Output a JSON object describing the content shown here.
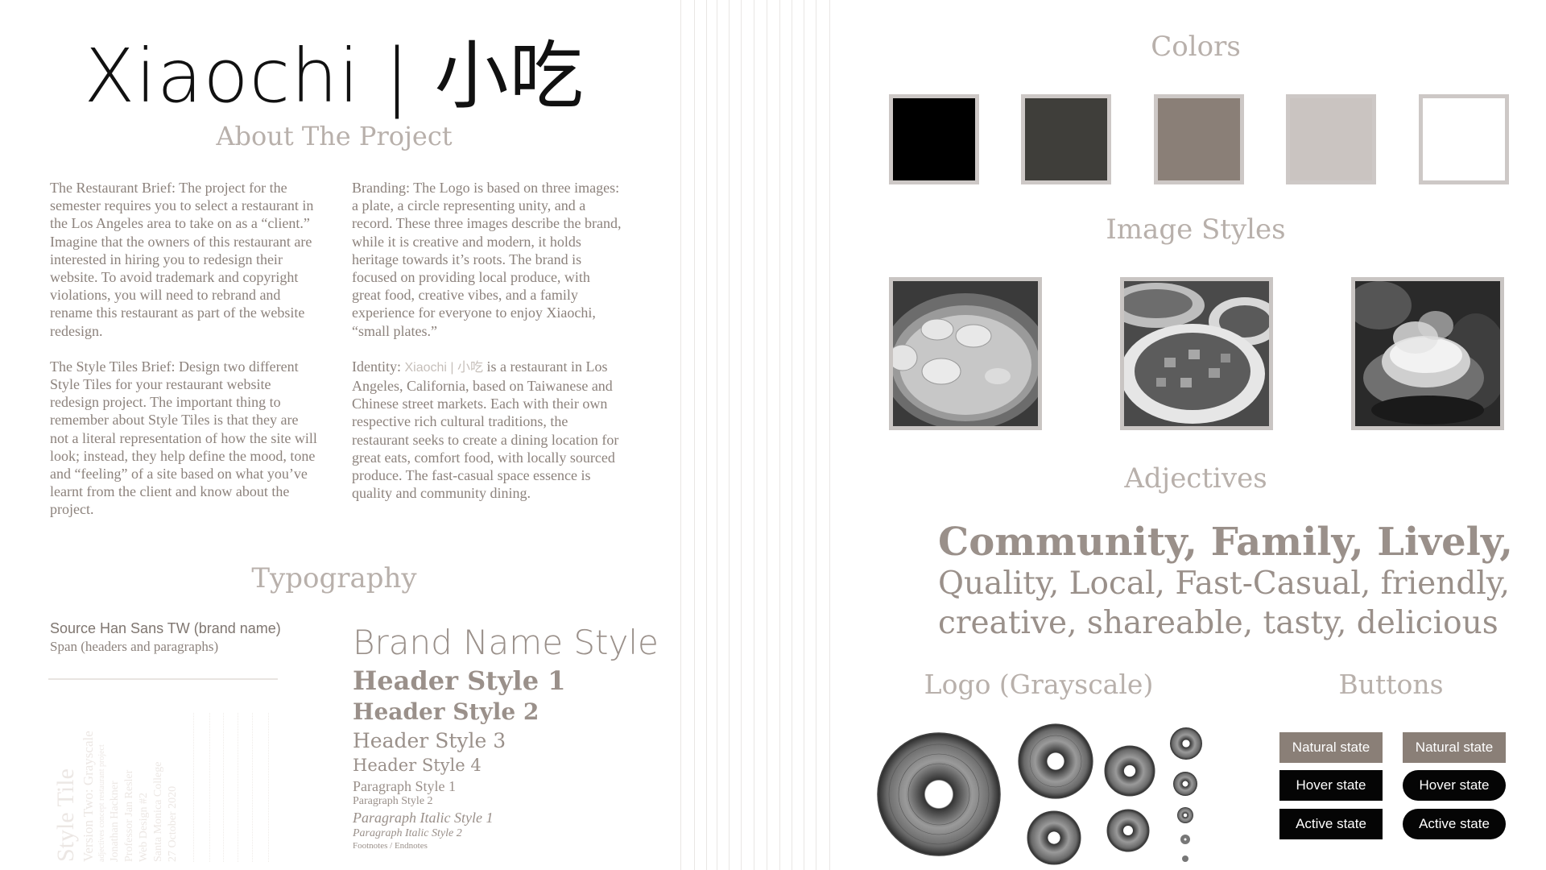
{
  "brand": {
    "title": "Xiaochi | 小吃"
  },
  "about": {
    "heading": "About The Project",
    "col1": [
      "The Restaurant Brief: The project for the semester requires you to select a restaurant in the Los Angeles area to take on as a “client.” Imagine that the owners of this restaurant are interested in hiring you to redesign their website. To avoid trademark and copyright violations, you will need to rebrand and rename this restaurant as part of the website redesign.",
      "The Style Tiles Brief: Design two different Style Tiles for your restaurant website redesign project. The important thing to remember about Style Tiles is that they are not a literal representation of how the site will look; instead, they help define the mood, tone and “feeling” of a site based on what you’ve learnt from the client and know about the project."
    ],
    "col2_p1": "Branding: The Logo is based on three images: a plate, a circle representing unity, and a record. These three images describe the brand, while it is creative and modern, it holds heritage towards it’s roots. The brand is focused on providing local produce, with great food, creative vibes, and a family experience for everyone to enjoy Xiaochi, “small plates.”",
    "identity_prefix": "Identity: ",
    "identity_brand": "Xiaochi | 小吃",
    "identity_rest": " is a restaurant in Los Angeles, California, based on Taiwanese and Chinese street markets. Each with their own respective rich cultural traditions, the restaurant seeks to create a dining location for great eats, comfort food, with locally sourced produce. The fast-casual space essence is quality and community dining."
  },
  "typography": {
    "heading": "Typography",
    "font1": "Source Han Sans TW (brand name)",
    "font2": "Span (headers and paragraphs)",
    "samples": {
      "brand": "Brand Name Style",
      "h1": "Header Style 1",
      "h2": "Header Style 2",
      "h3": "Header Style 3",
      "h4": "Header Style 4",
      "p1": "Paragraph Style 1",
      "p2": "Paragraph Style 2",
      "pi1": "Paragraph Italic Style 1",
      "pi2": "Paragraph Italic Style 2",
      "fn": "Footnotes / Endnotes"
    }
  },
  "tile_label": {
    "title": "Style Tile",
    "subtitle": "Version Two: Grayscale",
    "line1": "adjectives concept restaurant project",
    "line2": "Jonathan Hackner",
    "line3": "Professor Jan Resler",
    "line4": "Web Design #2",
    "line5": "Santa Monica College",
    "line6": "27 October 2020"
  },
  "colors": {
    "heading": "Colors",
    "swatches": [
      "#000000",
      "#3f3e3a",
      "#8a7f77",
      "#cac4c1",
      "#ffffff"
    ]
  },
  "images": {
    "heading": "Image Styles",
    "items": [
      "dumplings-photo",
      "tofu-dish-photo",
      "hot-pot-photo"
    ]
  },
  "adjectives": {
    "heading": "Adjectives",
    "line1": "Community, Family, Lively,",
    "line2": "Quality, Local, Fast-Casual, friendly,",
    "line3": "creative, shareable, tasty, delicious"
  },
  "logo": {
    "heading": "Logo (Grayscale)"
  },
  "buttons": {
    "heading": "Buttons",
    "natural": "Natural state",
    "hover": "Hover state",
    "active": "Active state"
  }
}
